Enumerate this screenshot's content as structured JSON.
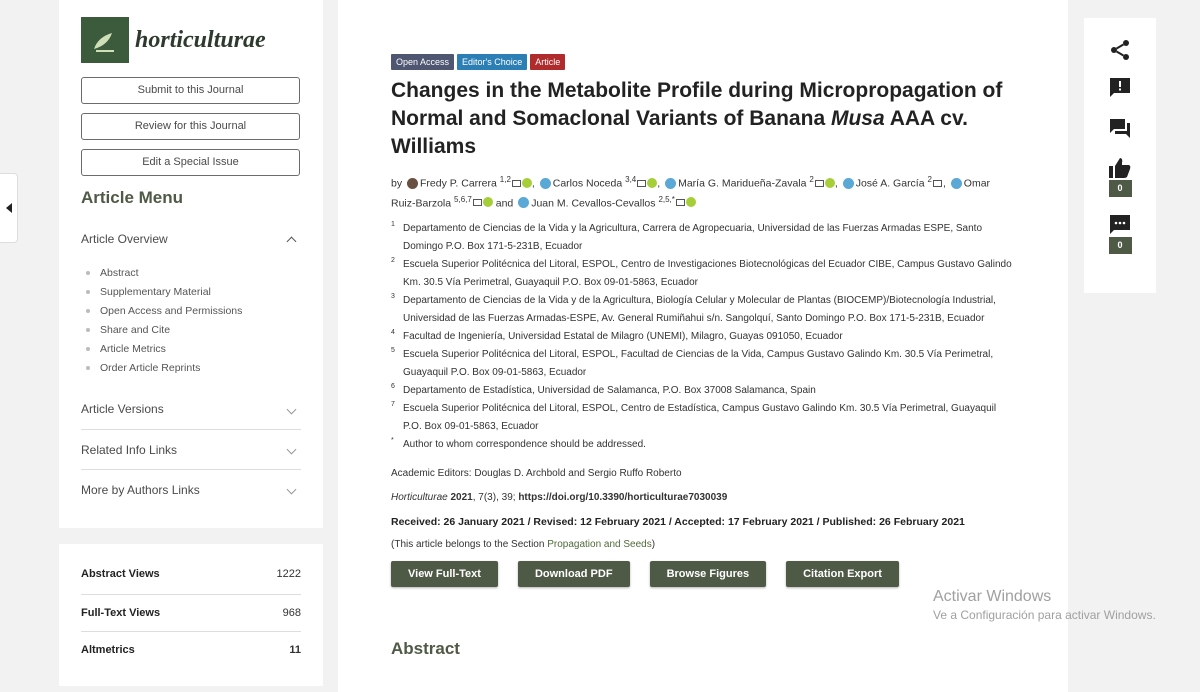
{
  "journal": {
    "name": "horticulturae"
  },
  "sidebar": {
    "buttons": [
      "Submit to this Journal",
      "Review for this Journal",
      "Edit a Special Issue"
    ],
    "menu_title": "Article Menu",
    "overview_label": "Article Overview",
    "overview_items": [
      "Abstract",
      "Supplementary Material",
      "Open Access and Permissions",
      "Share and Cite",
      "Article Metrics",
      "Order Article Reprints"
    ],
    "collapsed_sections": [
      "Article Versions",
      "Related Info Links",
      "More by Authors Links"
    ]
  },
  "stats": [
    {
      "label": "Abstract Views",
      "value": "1222"
    },
    {
      "label": "Full-Text Views",
      "value": "968"
    },
    {
      "label": "Altmetrics",
      "value": "11"
    }
  ],
  "article": {
    "badges": [
      "Open Access",
      "Editor's Choice",
      "Article"
    ],
    "title_part1": "Changes in the Metabolite Profile during Micropropagation of Normal and Somaclonal Variants of Banana ",
    "title_italic": "Musa",
    "title_part2": " AAA cv. Williams",
    "by": "by",
    "authors": [
      {
        "name": "Fredy P. Carrera",
        "sup": "1,2"
      },
      {
        "name": "Carlos Noceda",
        "sup": "3,4"
      },
      {
        "name": "María G. Maridueña-Zavala",
        "sup": "2"
      },
      {
        "name": "José A. García",
        "sup": "2"
      },
      {
        "name": "Omar Ruiz-Barzola",
        "sup": "5,6,7"
      },
      {
        "name": "Juan M. Cevallos-Cevallos",
        "sup": "2,5,*"
      }
    ],
    "and_word": "and",
    "affiliations": [
      {
        "num": "1",
        "text": "Departamento de Ciencias de la Vida y la Agricultura, Carrera de Agropecuaria, Universidad de las Fuerzas Armadas ESPE, Santo Domingo P.O. Box 171-5-231B, Ecuador"
      },
      {
        "num": "2",
        "text": "Escuela Superior Politécnica del Litoral, ESPOL, Centro de Investigaciones Biotecnológicas del Ecuador CIBE, Campus Gustavo Galindo Km. 30.5 Vía Perimetral, Guayaquil P.O. Box 09-01-5863, Ecuador"
      },
      {
        "num": "3",
        "text": "Departamento de Ciencias de la Vida y de la Agricultura, Biología Celular y Molecular de Plantas (BIOCEMP)/Biotecnología Industrial, Universidad de las Fuerzas Armadas-ESPE, Av. General Rumiñahui s/n. Sangolquí, Santo Domingo P.O. Box 171-5-231B, Ecuador"
      },
      {
        "num": "4",
        "text": "Facultad de Ingeniería, Universidad Estatal de Milagro (UNEMI), Milagro, Guayas 091050, Ecuador"
      },
      {
        "num": "5",
        "text": "Escuela Superior Politécnica del Litoral, ESPOL, Facultad de Ciencias de la Vida, Campus Gustavo Galindo Km. 30.5 Vía Perimetral, Guayaquil P.O. Box 09-01-5863, Ecuador"
      },
      {
        "num": "6",
        "text": "Departamento de Estadística, Universidad de Salamanca, P.O. Box 37008 Salamanca, Spain"
      },
      {
        "num": "7",
        "text": "Escuela Superior Politécnica del Litoral, ESPOL, Centro de Estadística, Campus Gustavo Galindo Km. 30.5 Vía Perimetral, Guayaquil P.O. Box 09-01-5863, Ecuador"
      },
      {
        "num": "*",
        "text": "Author to whom correspondence should be addressed."
      }
    ],
    "academic_editors": "Academic Editors: Douglas D. Archbold and Sergio Ruffo Roberto",
    "citation_journal": "Horticulturae",
    "citation_year": "2021",
    "citation_rest": ", 7(3), 39; ",
    "doi": "https://doi.org/10.3390/horticulturae7030039",
    "dates": "Received: 26 January 2021 / Revised: 12 February 2021 / Accepted: 17 February 2021 / Published: 26 February 2021",
    "section_prefix": "(This article belongs to the Section ",
    "section_name": "Propagation and Seeds",
    "section_suffix": ")",
    "actions": [
      "View Full-Text",
      "Download PDF",
      "Browse Figures",
      "Citation Export"
    ],
    "abstract_heading": "Abstract"
  },
  "share_panel": {
    "icons": [
      "share-icon",
      "report-icon",
      "comment-icon",
      "like-icon",
      "discussion-icon"
    ],
    "like_count": "0",
    "comment_count": "0"
  },
  "watermark": {
    "line1": "Activar Windows",
    "line2": "Ve a Configuración para activar Windows."
  }
}
